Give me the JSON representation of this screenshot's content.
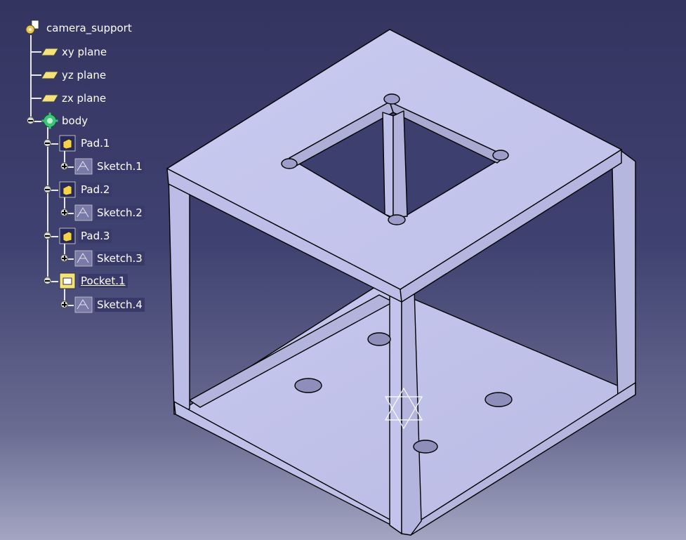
{
  "tree": {
    "root": "camera_support",
    "planes": [
      "xy plane",
      "yz plane",
      "zx plane"
    ],
    "body": "body",
    "features": [
      {
        "name": "Pad.1",
        "sketch": "Sketch.1"
      },
      {
        "name": "Pad.2",
        "sketch": "Sketch.2"
      },
      {
        "name": "Pad.3",
        "sketch": "Sketch.3"
      },
      {
        "name": "Pocket.1",
        "sketch": "Sketch.4"
      }
    ]
  },
  "colors": {
    "face_top": "#c7c8ed",
    "face_left": "#bdbee6",
    "face_right": "#b7b8e0",
    "face_floor": "#c2c3ea",
    "edge": "#000000"
  },
  "icons": {
    "root": "part-gear-icon",
    "plane": "plane-icon",
    "body": "body-gear-icon",
    "pad": "pad-icon",
    "pocket": "pocket-icon",
    "sketch": "sketch-icon",
    "compass": "compass-icon"
  }
}
